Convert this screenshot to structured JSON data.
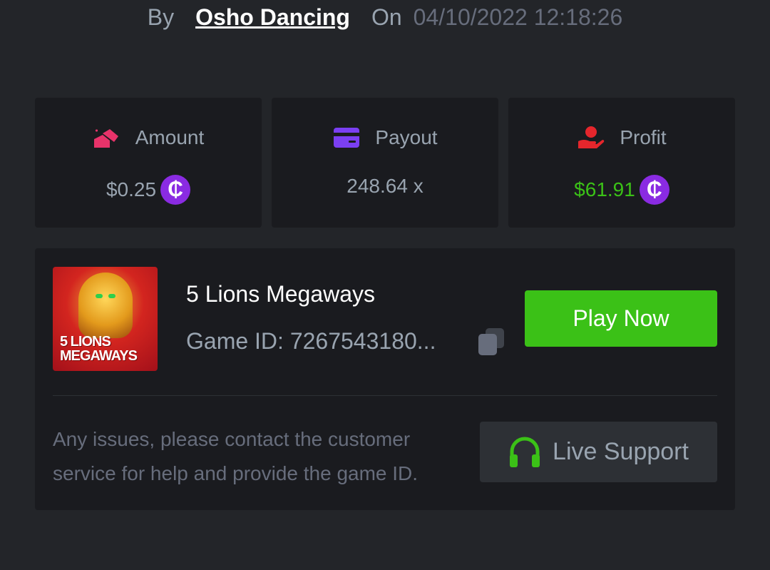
{
  "byline": {
    "by_label": "By",
    "user": "Osho Dancing",
    "on_label": "On",
    "datetime": "04/10/2022 12:18:26"
  },
  "stats": {
    "amount": {
      "label": "Amount",
      "value": "$0.25",
      "icon": "bet-amount-icon",
      "color": "#e8336a"
    },
    "payout": {
      "label": "Payout",
      "value": "248.64 x",
      "icon": "card-icon",
      "color": "#7b3ff2"
    },
    "profit": {
      "label": "Profit",
      "value": "$61.91",
      "icon": "profit-hand-icon",
      "color": "#e5262c",
      "value_color": "#3bc117"
    },
    "coin_symbol": "₵",
    "coin_color": "#8a2be2"
  },
  "game": {
    "thumb_line1": "5 LIONS",
    "thumb_line2": "MEGAWAYS",
    "title": "5 Lions Megaways",
    "game_id": "Game ID: 7267543180...",
    "play_label": "Play Now",
    "play_color": "#3bc117"
  },
  "support": {
    "help_text": "Any issues, please contact the customer service for help and provide the game ID.",
    "button_label": "Live Support",
    "icon": "headset-icon"
  }
}
